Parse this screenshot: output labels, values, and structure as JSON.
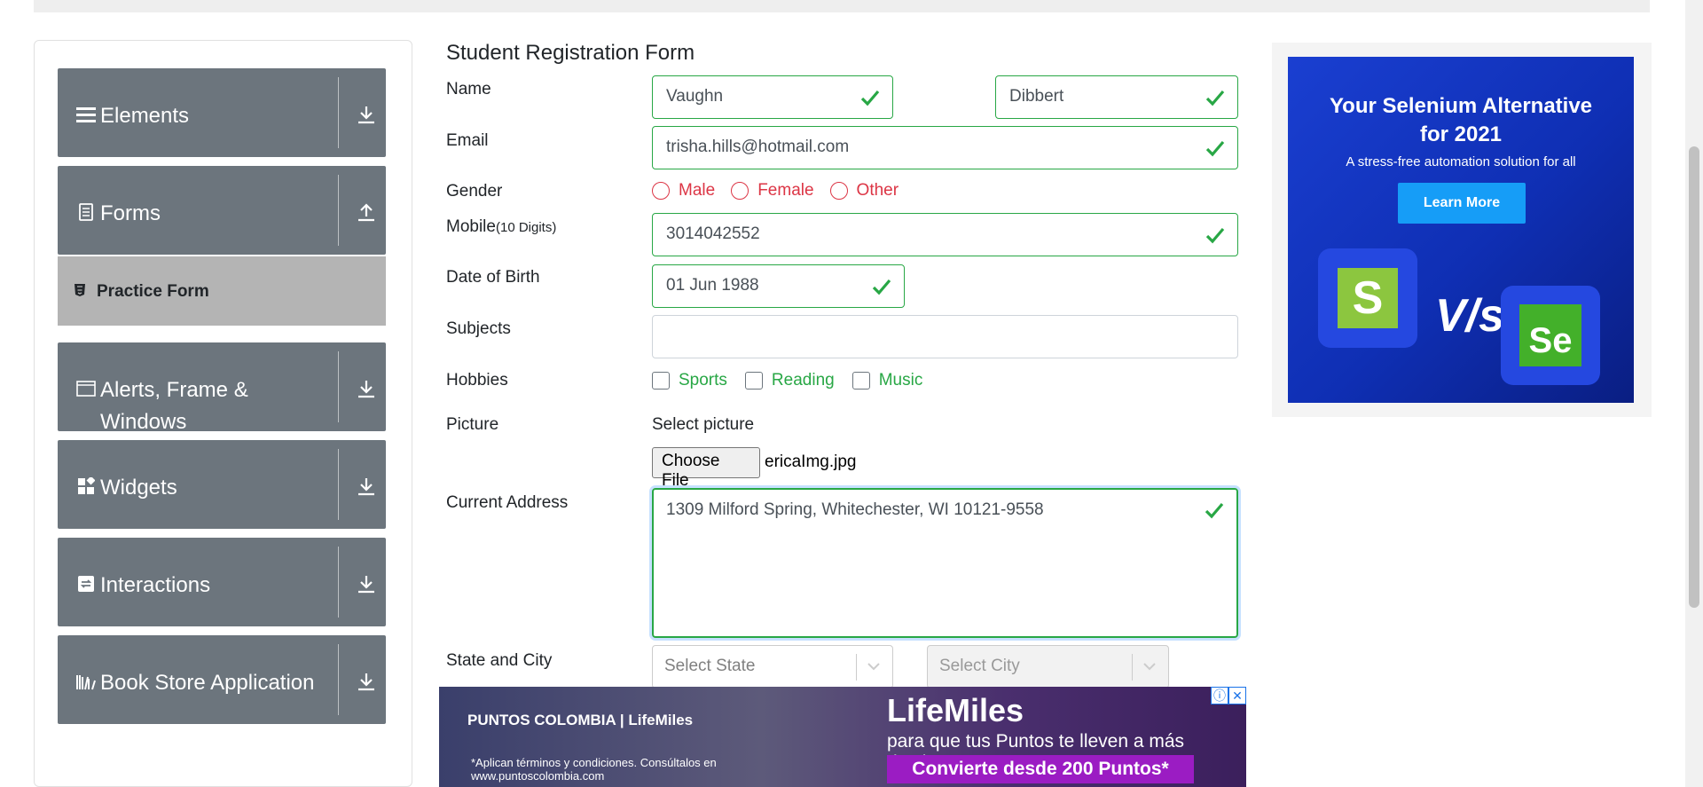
{
  "sidebar": {
    "groups": [
      {
        "label": "Elements",
        "icon": "hamburger-icon",
        "arrow": "download-arrow-icon"
      },
      {
        "label": "Forms",
        "icon": "document-icon",
        "arrow": "upload-arrow-icon"
      },
      {
        "label": "Alerts, Frame & Windows",
        "icon": "window-icon",
        "arrow": "download-arrow-icon"
      },
      {
        "label": "Widgets",
        "icon": "widgets-icon",
        "arrow": "download-arrow-icon"
      },
      {
        "label": "Interactions",
        "icon": "interactions-icon",
        "arrow": "download-arrow-icon"
      },
      {
        "label": "Book Store Application",
        "icon": "books-icon",
        "arrow": "download-arrow-icon"
      }
    ],
    "active_item": "Practice Form"
  },
  "form": {
    "title": "Student Registration Form",
    "labels": {
      "name": "Name",
      "email": "Email",
      "gender": "Gender",
      "mobile": "Mobile",
      "mobile_hint": "(10 Digits)",
      "dob": "Date of Birth",
      "subjects": "Subjects",
      "hobbies": "Hobbies",
      "picture": "Picture",
      "address": "Current Address",
      "state_city": "State and City"
    },
    "first_name": "Vaughn",
    "last_name": "Dibbert",
    "email": "trisha.hills@hotmail.com",
    "gender_options": [
      "Male",
      "Female",
      "Other"
    ],
    "mobile": "3014042552",
    "dob": "01 Jun 1988",
    "subjects": "",
    "hobby_options": [
      "Sports",
      "Reading",
      "Music"
    ],
    "select_picture": "Select picture",
    "choose_file": "Choose File",
    "file_name": "ericaImg.jpg",
    "address": "1309 Milford Spring, Whitechester, WI 10121-9558",
    "state_placeholder": "Select State",
    "city_placeholder": "Select City"
  },
  "ad_right": {
    "title_line1": "Your Selenium Alternative",
    "title_line2": "for 2021",
    "subtitle": "A stress-free automation solution for all",
    "button": "Learn More",
    "vs": "V/s",
    "logo_left": "S",
    "logo_right": "Se"
  },
  "ad_bottom": {
    "brand": "PUNTOS COLOMBIA | LifeMiles",
    "fine_print": "*Aplican términos y condiciones. Consúltalos en www.puntoscolombia.com",
    "headline": "LifeMiles",
    "tagline": "para que tus Puntos te lleven a más destinos.",
    "cta": "Convierte desde 200 Puntos*"
  },
  "colors": {
    "valid": "#28a745",
    "invalid": "#dc3545",
    "sidebar": "#6c757d",
    "ad_blue": "#1a3fd1"
  }
}
